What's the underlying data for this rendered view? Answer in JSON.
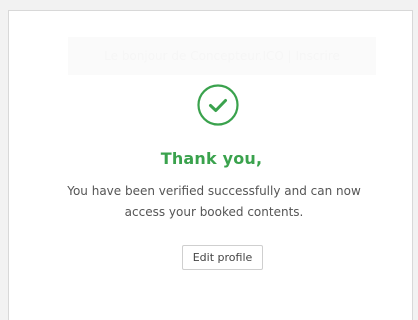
{
  "banner": {
    "text": "Le bonjour de Concepteur.ICO | Inscrire"
  },
  "success": {
    "icon": "check-circle-icon",
    "accent_color": "#3aa24d",
    "title": "Thank you,",
    "message": "You have been verified successfully and can now access your booked contents."
  },
  "actions": {
    "edit_profile_label": "Edit profile"
  }
}
